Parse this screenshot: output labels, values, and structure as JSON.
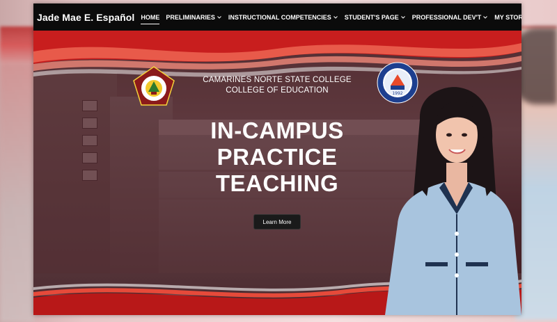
{
  "navbar": {
    "brand": "Jade Mae E. Español",
    "items": [
      {
        "label": "HOME",
        "active": true,
        "dropdown": false
      },
      {
        "label": "PRELIMINARIES",
        "active": false,
        "dropdown": true
      },
      {
        "label": "INSTRUCTIONAL COMPETENCIES",
        "active": false,
        "dropdown": true
      },
      {
        "label": "STUDENT'S PAGE",
        "active": false,
        "dropdown": true
      },
      {
        "label": "PROFESSIONAL DEV'T",
        "active": false,
        "dropdown": true
      },
      {
        "label": "MY STORY",
        "active": false,
        "dropdown": false
      }
    ]
  },
  "hero": {
    "college_line1": "CAMARINES NORTE STATE COLLEGE",
    "college_line2": "COLLEGE OF EDUCATION",
    "headline_line1": "IN-CAMPUS",
    "headline_line2": "PRACTICE",
    "headline_line3": "TEACHING",
    "button_label": "Learn More",
    "logo_right_year": "1992"
  },
  "colors": {
    "navbar_bg": "#0b0b0b",
    "accent_red": "#c81e1e",
    "button_bg": "#1a1a1a",
    "uniform_blue": "#a8c4de"
  },
  "icons": {
    "left_logo": "college-seal-icon",
    "right_logo": "education-seal-icon",
    "caret": "chevron-down-icon"
  }
}
